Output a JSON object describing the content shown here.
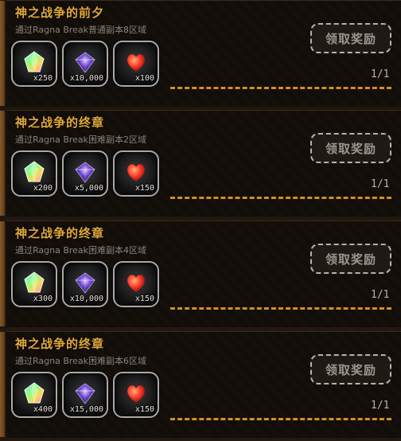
{
  "achievements": [
    {
      "title": "神之战争的前夕",
      "desc": "通过Ragna Break普通副本8区域",
      "rewards": [
        {
          "icon": "rainbow-crystal-icon",
          "qty": "x250"
        },
        {
          "icon": "purple-gem-icon",
          "qty": "x10,000"
        },
        {
          "icon": "heart-icon",
          "qty": "x100"
        }
      ],
      "claim_label": "领取奖励",
      "progress_text": "1/1",
      "progress": 1.0
    },
    {
      "title": "神之战争的终章",
      "desc": "通过Ragna Break困难副本2区域",
      "rewards": [
        {
          "icon": "rainbow-crystal-icon",
          "qty": "x200"
        },
        {
          "icon": "purple-gem-icon",
          "qty": "x5,000"
        },
        {
          "icon": "heart-icon",
          "qty": "x150"
        }
      ],
      "claim_label": "领取奖励",
      "progress_text": "1/1",
      "progress": 1.0
    },
    {
      "title": "神之战争的终章",
      "desc": "通过Ragna Break困难副本4区域",
      "rewards": [
        {
          "icon": "rainbow-crystal-icon",
          "qty": "x300"
        },
        {
          "icon": "purple-gem-icon",
          "qty": "x10,000"
        },
        {
          "icon": "heart-icon",
          "qty": "x150"
        }
      ],
      "claim_label": "领取奖励",
      "progress_text": "1/1",
      "progress": 1.0
    },
    {
      "title": "神之战争的终章",
      "desc": "通过Ragna Break困难副本6区域",
      "rewards": [
        {
          "icon": "rainbow-crystal-icon",
          "qty": "x400"
        },
        {
          "icon": "purple-gem-icon",
          "qty": "x15,000"
        },
        {
          "icon": "heart-icon",
          "qty": "x150"
        }
      ],
      "claim_label": "领取奖励",
      "progress_text": "1/1",
      "progress": 1.0
    }
  ],
  "colors": {
    "title": "#e1a93a",
    "progress": "#d48f1e",
    "accent_side": "#8a5a25"
  }
}
